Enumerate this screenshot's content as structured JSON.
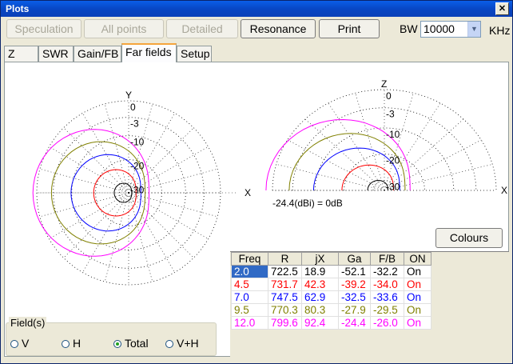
{
  "window": {
    "title": "Plots",
    "close_label": "✕"
  },
  "toolbar": {
    "speculation_label": "Speculation",
    "all_points_label": "All points",
    "detailed_label": "Detailed",
    "resonance_label": "Resonance",
    "print_label": "Print",
    "bw_label": "BW",
    "bw_value": "10000",
    "khz_label": "KHz"
  },
  "tabs": [
    {
      "label": "Z"
    },
    {
      "label": "SWR"
    },
    {
      "label": "Gain/FB"
    },
    {
      "label": "Far fields",
      "active": true
    },
    {
      "label": "Setup"
    }
  ],
  "plots": {
    "left": {
      "axis_y_label": "Y",
      "axis_x_label": "X",
      "ring_labels": [
        "0",
        "-3",
        "-10",
        "-20",
        "-30"
      ]
    },
    "right": {
      "axis_z_label": "Z",
      "axis_x_label": "X",
      "ring_labels": [
        "0",
        "-3",
        "-10",
        "-20",
        "-30"
      ],
      "reference_note": "-24.4(dBi) = 0dB"
    }
  },
  "colours_label": "Colours",
  "fields": {
    "title": "Field(s)",
    "options": [
      {
        "label": "V",
        "selected": false
      },
      {
        "label": "H",
        "selected": false
      },
      {
        "label": "Total",
        "selected": true
      },
      {
        "label": "V+H",
        "selected": false
      }
    ]
  },
  "table": {
    "headers": [
      "Freq",
      "R",
      "jX",
      "Ga",
      "F/B",
      "ON"
    ],
    "rows": [
      {
        "color": "#000000",
        "cells": [
          "2.0",
          "722.5",
          "18.9",
          "-52.1",
          "-32.2",
          "On"
        ]
      },
      {
        "color": "#ff0000",
        "cells": [
          "4.5",
          "731.7",
          "42.3",
          "-39.2",
          "-34.0",
          "On"
        ]
      },
      {
        "color": "#0000ff",
        "cells": [
          "7.0",
          "747.5",
          "62.9",
          "-32.5",
          "-33.6",
          "On"
        ]
      },
      {
        "color": "#808000",
        "cells": [
          "9.5",
          "770.3",
          "80.3",
          "-27.9",
          "-29.5",
          "On"
        ]
      },
      {
        "color": "#ff00ff",
        "cells": [
          "12.0",
          "799.6",
          "92.4",
          "-24.4",
          "-26.0",
          "On"
        ]
      }
    ]
  }
}
